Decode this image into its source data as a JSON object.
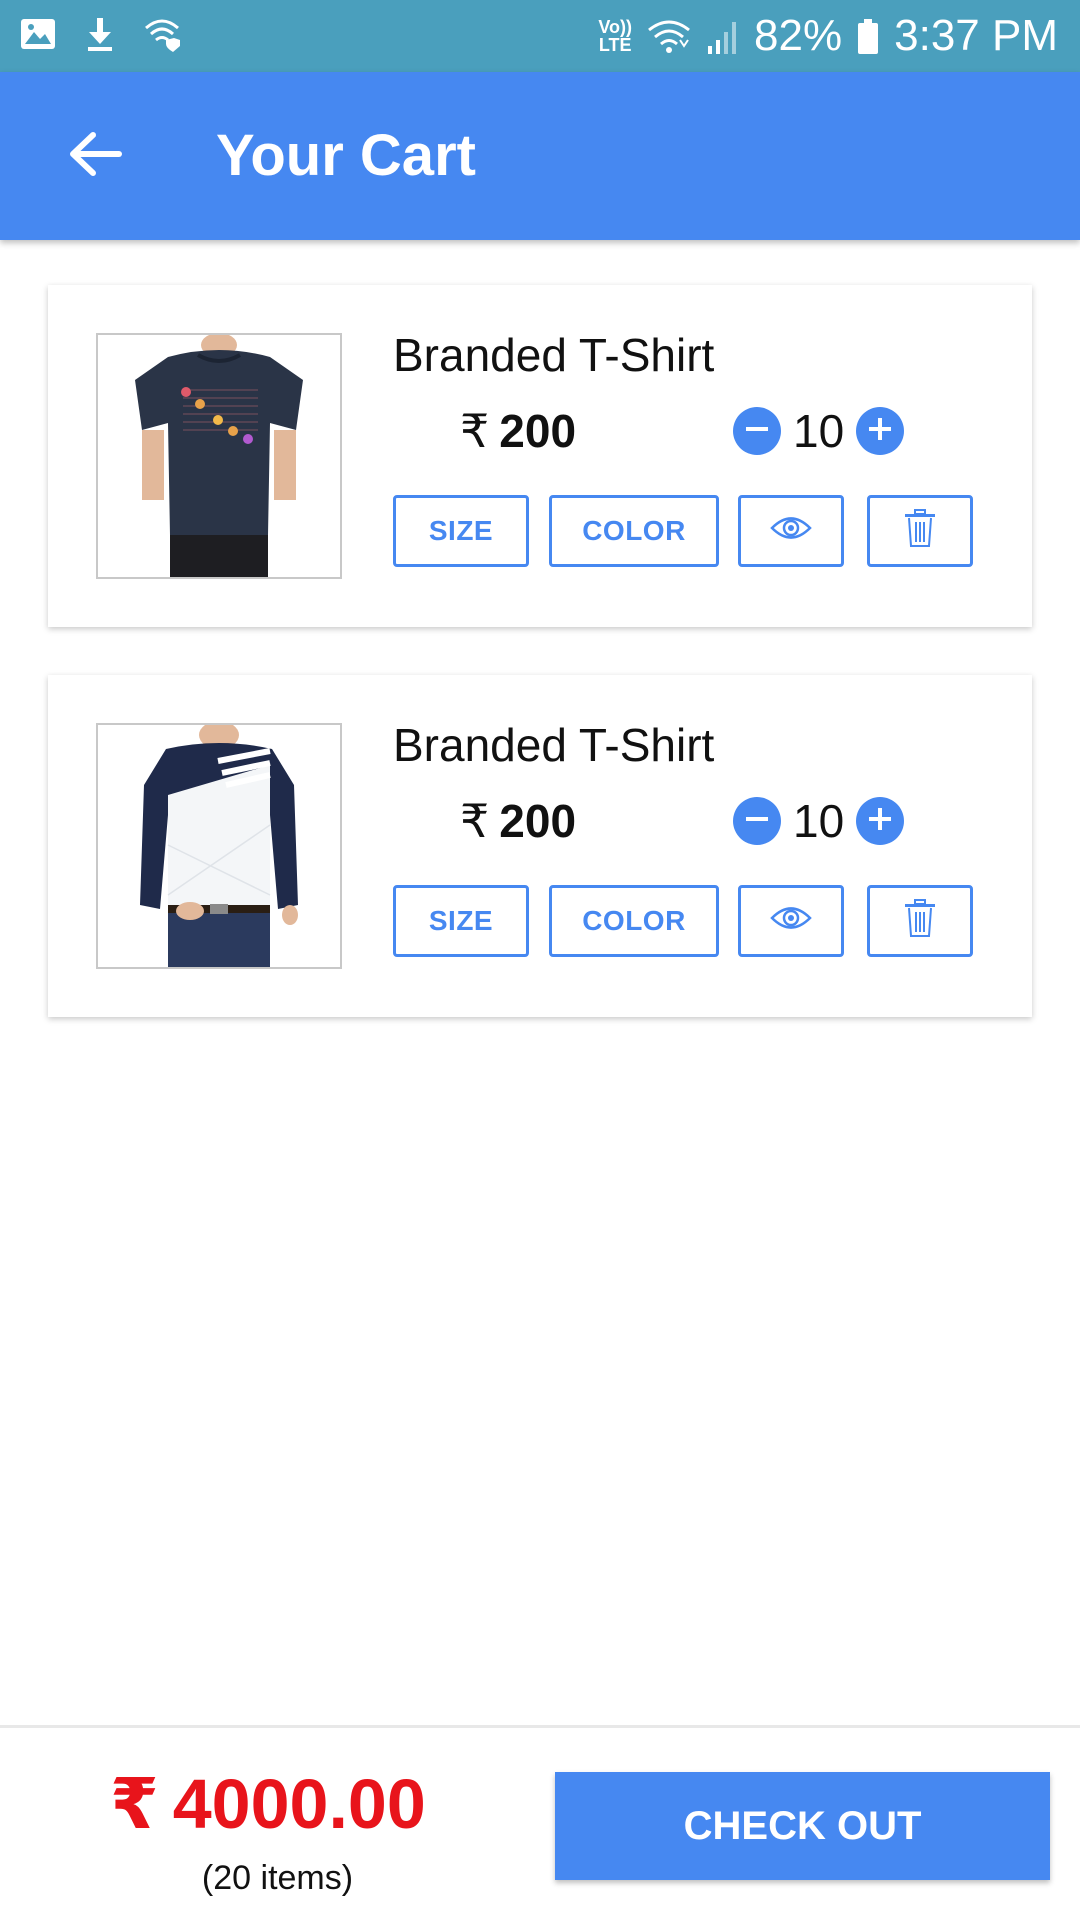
{
  "status_bar": {
    "left_icons": [
      "image-icon",
      "download-icon",
      "wifi-shield-icon"
    ],
    "volte_label_top": "Vo))",
    "volte_label_bottom": "LTE",
    "battery_percent": "82%",
    "time": "3:37 PM"
  },
  "app_bar": {
    "title": "Your Cart",
    "back_icon": "arrow-left-icon"
  },
  "cart": {
    "items": [
      {
        "name": "Branded T-Shirt",
        "currency": "₹",
        "price": "200",
        "quantity": "10",
        "size_label": "SIZE",
        "color_label": "COLOR",
        "image": "navy-tshirt-image"
      },
      {
        "name": "Branded T-Shirt",
        "currency": "₹",
        "price": "200",
        "quantity": "10",
        "size_label": "SIZE",
        "color_label": "COLOR",
        "image": "navy-white-longsleeve-image"
      }
    ]
  },
  "footer": {
    "currency": "₹",
    "total": "4000.00",
    "items_count": "(20 items)",
    "checkout_label": "CHECK OUT"
  },
  "colors": {
    "status_bar": "#4a9fbd",
    "primary": "#4688f1",
    "total": "#e8141b"
  }
}
